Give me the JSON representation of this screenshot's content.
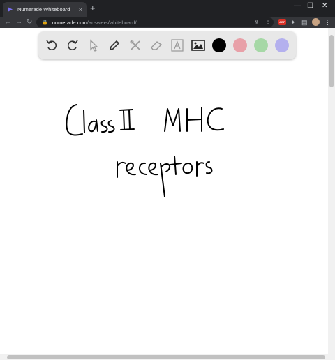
{
  "browser": {
    "tab_title": "Numerade Whiteboard",
    "tab_close": "×",
    "new_tab": "+",
    "window_controls": {
      "minimize": "—",
      "maximize": "☐",
      "close": "✕"
    },
    "url_host": "numerade.com",
    "url_path": "/answers/whiteboard/",
    "extension_badge": "ABP"
  },
  "whiteboard": {
    "tools": [
      "undo-icon",
      "redo-icon",
      "select-icon",
      "pen-icon",
      "tools-icon",
      "eraser-icon",
      "text-icon",
      "image-icon"
    ],
    "colors": [
      "#000000",
      "#e8a0a8",
      "#a6d8a6",
      "#b4b0ee"
    ],
    "handwriting": [
      "Class II MHC",
      "receptors"
    ]
  }
}
